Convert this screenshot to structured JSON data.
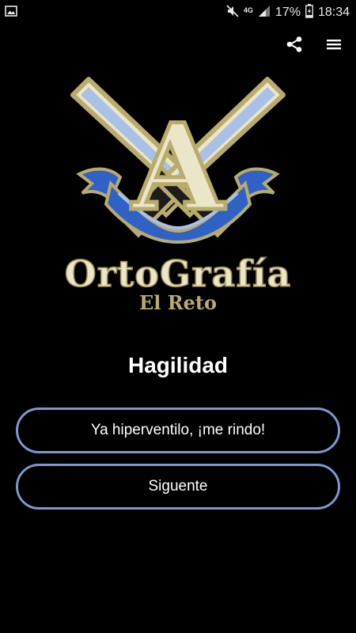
{
  "status_bar": {
    "notification_icon": "image-icon",
    "mute_icon": "mute-icon",
    "network_label": "4G",
    "signal_icon": "signal-icon",
    "battery_percent": "17%",
    "battery_icon": "battery-charging-icon",
    "time": "18:34"
  },
  "app_bar": {
    "share_icon": "share-icon",
    "menu_icon": "menu-icon"
  },
  "logo": {
    "letter": "A",
    "title": "OrtoGrafía",
    "subtitle": "El Reto"
  },
  "main": {
    "title": "Hagilidad"
  },
  "buttons": {
    "give_up": "Ya hiperventilo, ¡me rindo!",
    "next": "Siguente"
  },
  "colors": {
    "background": "#000000",
    "button_border": "#7f97cc",
    "logo_gold": "#b9ab6b",
    "logo_blue": "#2f62c4",
    "logo_cream": "#ece6c9"
  }
}
